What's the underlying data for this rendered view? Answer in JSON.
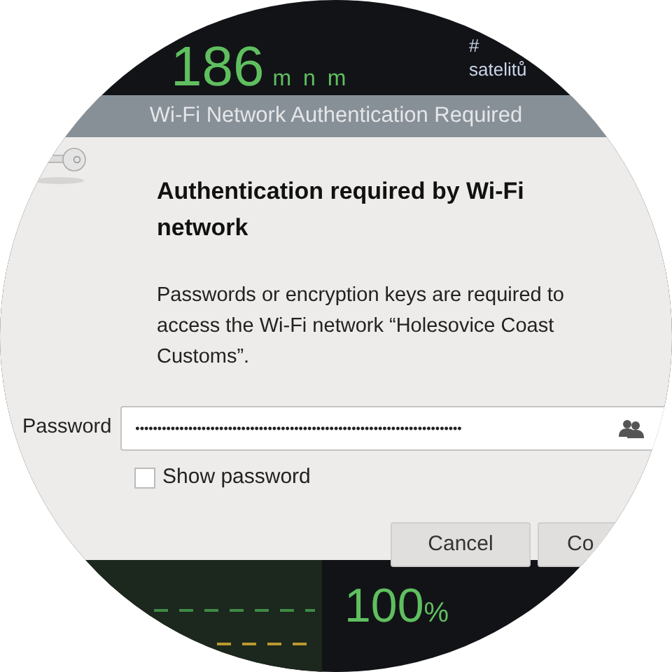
{
  "dashboard": {
    "speed": {
      "value": "186",
      "unit": "m n m"
    },
    "satellites": {
      "symbol": "#",
      "label": "satelitů"
    },
    "level": {
      "value": "100",
      "unit": "%"
    }
  },
  "dialog": {
    "title": "Wi-Fi Network Authentication Required",
    "heading": "Authentication required by Wi-Fi network",
    "message": "Passwords or encryption keys are required to access the Wi-Fi network “Holesovice Coast Customs”.",
    "password": {
      "label": "Password",
      "value": "••••••••••••••••••••••••••••••••••••••••••••••••••••••••••••••••••••••••••"
    },
    "show_password": {
      "label": "Show password",
      "checked": false
    },
    "buttons": [
      {
        "label": "Cancel"
      },
      {
        "label": "Co"
      }
    ]
  }
}
